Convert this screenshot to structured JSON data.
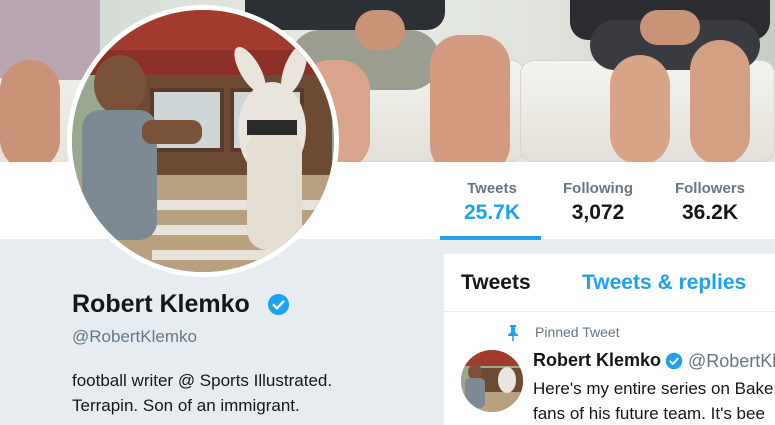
{
  "profile": {
    "name": "Robert Klemko",
    "handle": "@RobertKlemko",
    "bio_line1": "football writer @ Sports Illustrated.",
    "bio_line2": "Terrapin. Son of an immigrant."
  },
  "stats": [
    {
      "label": "Tweets",
      "value": "25.7K"
    },
    {
      "label": "Following",
      "value": "3,072"
    },
    {
      "label": "Followers",
      "value": "36.2K"
    }
  ],
  "tabs": {
    "tweets": "Tweets",
    "replies": "Tweets & replies"
  },
  "pinned_tweet": {
    "pinned_label": "Pinned Tweet",
    "author_name": "Robert Klemko",
    "author_handle": "@RobertKle",
    "text_line1": "Here's my entire series on Bake",
    "text_line2": "fans of his future team. It's bee"
  },
  "colors": {
    "accent": "#1da1f2",
    "muted": "#657786",
    "text": "#14171a",
    "panel": "#e6ecf0"
  },
  "icons": [
    "verified-badge-icon",
    "pin-icon"
  ]
}
